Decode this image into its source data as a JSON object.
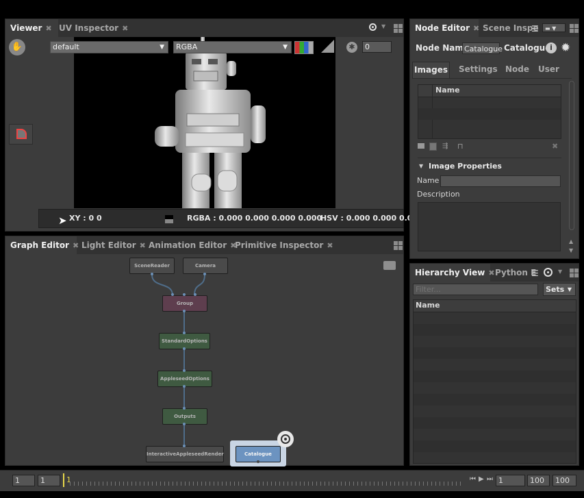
{
  "viewer": {
    "tabs": [
      {
        "label": "Viewer",
        "active": true
      },
      {
        "label": "UV Inspector",
        "active": false
      }
    ],
    "display_transform": "default",
    "channels": "RGBA",
    "exposure": "0",
    "status": {
      "xy": "XY : 0 0",
      "rgba": "RGBA : 0.000 0.000 0.000 0.000",
      "hsv": "HSV : 0.000 0.000 0.0"
    }
  },
  "node_editor": {
    "tabs": [
      {
        "label": "Node Editor",
        "active": true
      },
      {
        "label": "Scene Inspe",
        "active": false
      }
    ],
    "node_name_label": "Node Name",
    "node_name_value": "Catalogue",
    "node_type": "Catalogue",
    "subtabs": [
      "Images",
      "Settings",
      "Node",
      "User"
    ],
    "images_column": "Name",
    "image_properties_title": "Image Properties",
    "name_label": "Name",
    "description_label": "Description"
  },
  "graph_editor": {
    "tabs": [
      {
        "label": "Graph Editor",
        "active": true
      },
      {
        "label": "Light Editor",
        "active": false
      },
      {
        "label": "Animation Editor",
        "active": false
      },
      {
        "label": "Primitive Inspector",
        "active": false
      }
    ],
    "nodes": [
      "SceneReader",
      "Camera",
      "Group",
      "StandardOptions",
      "AppleseedOptions",
      "Outputs",
      "InteractiveAppleseedRender",
      "Catalogue"
    ]
  },
  "hierarchy": {
    "tabs": [
      {
        "label": "Hierarchy View",
        "active": true
      },
      {
        "label": "Python E",
        "active": false
      }
    ],
    "filter_placeholder": "Filter...",
    "sets_label": "Sets",
    "column": "Name"
  },
  "timeline": {
    "start": "1",
    "range_start": "1",
    "current_marker": "1",
    "current_frame": "1",
    "range_end": "100",
    "end": "100"
  },
  "colors": {
    "accent": "#7f9fc6",
    "group_node": "#5e3e4e",
    "options_node": "#3f5a41",
    "catalogue_node": "#6c93c0"
  }
}
